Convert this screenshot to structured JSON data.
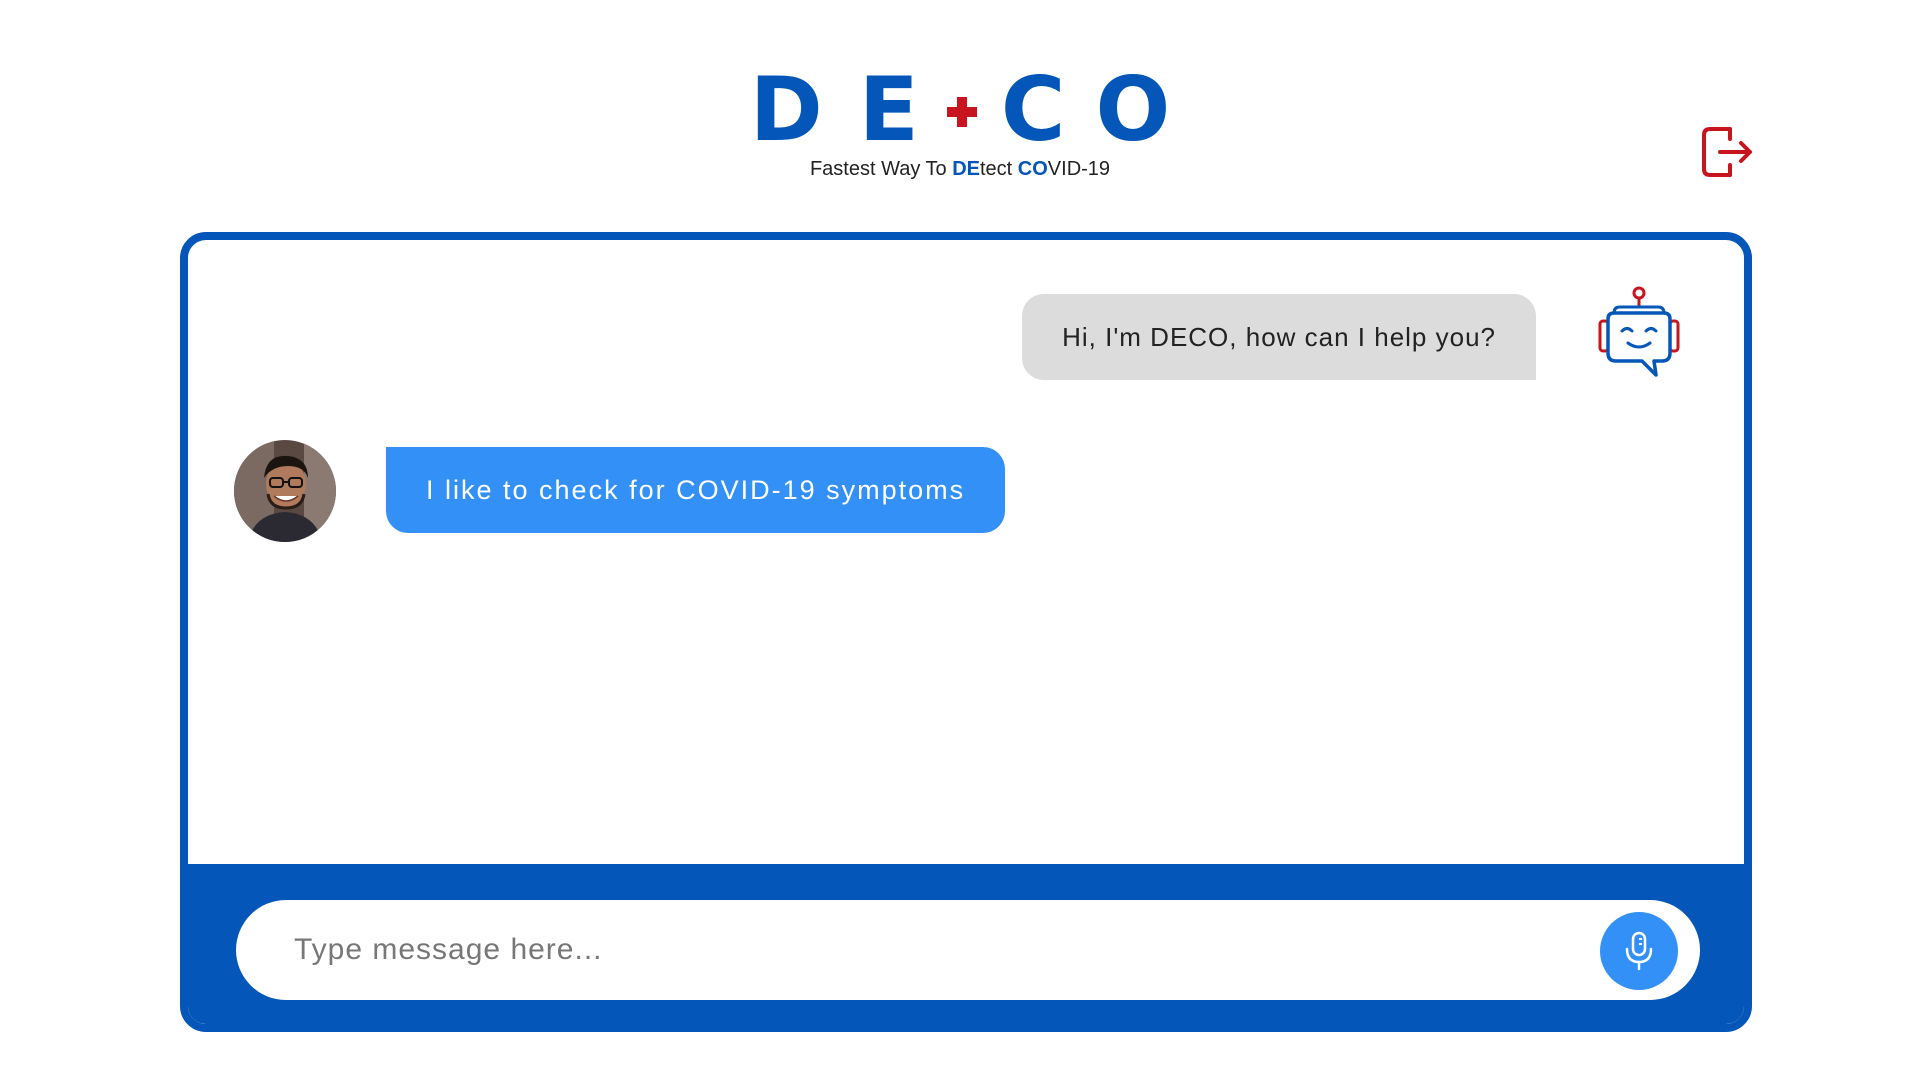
{
  "header": {
    "logo_left": "DE",
    "logo_right": "CO",
    "tagline": {
      "prefix": "Fastest Way To ",
      "hl1": "DE",
      "mid": "tect ",
      "hl2": "CO",
      "suffix": "VID-19"
    },
    "logout_icon": "logout-icon"
  },
  "chat": {
    "messages": [
      {
        "sender": "bot",
        "text": "Hi, I'm DECO, how can I help you?"
      },
      {
        "sender": "user",
        "text": "I like to check for COVID-19 symptoms"
      }
    ],
    "input": {
      "placeholder": "Type message here...",
      "value": ""
    },
    "mic_icon": "microphone-icon",
    "bot_icon": "robot-chat-icon"
  },
  "colors": {
    "brand_blue": "#0456b9",
    "accent_red": "#c8141e",
    "user_bubble": "#3390f7",
    "bot_bubble": "#dcdcdc"
  }
}
